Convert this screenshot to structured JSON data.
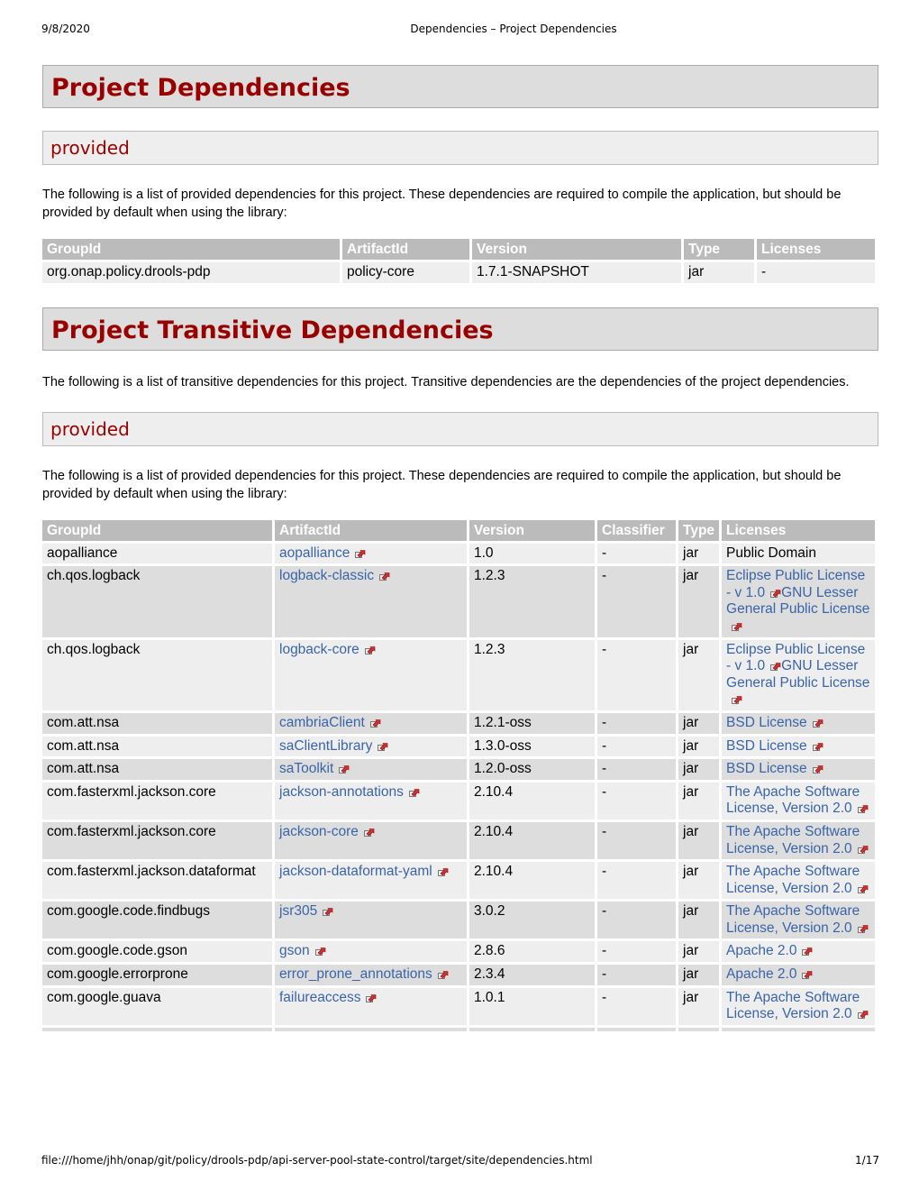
{
  "print": {
    "date": "9/8/2020",
    "title": "Dependencies – Project Dependencies",
    "url": "file:///home/jhh/onap/git/policy/drools-pdp/api-server-pool-state-control/target/site/dependencies.html",
    "page": "1/17"
  },
  "colors": {
    "heading": "#990000",
    "link": "#3a64a8",
    "table_header": "#bbbbbb",
    "row_odd": "#eeeeee",
    "row_even": "#dddddd"
  },
  "section1": {
    "title": "Project Dependencies",
    "subsection": "provided",
    "intro": "The following is a list of provided dependencies for this project. These dependencies are required to compile the application, but should be provided by default when using the library:",
    "columns": [
      "GroupId",
      "ArtifactId",
      "Version",
      "Type",
      "Licenses"
    ],
    "rows": [
      {
        "groupId": "org.onap.policy.drools-pdp",
        "artifactId": "policy-core",
        "version": "1.7.1-SNAPSHOT",
        "type": "jar",
        "licenses": "-"
      }
    ]
  },
  "section2": {
    "title": "Project Transitive Dependencies",
    "intro": "The following is a list of transitive dependencies for this project. Transitive dependencies are the dependencies of the project dependencies.",
    "subsection": "provided",
    "sub_intro": "The following is a list of provided dependencies for this project. These dependencies are required to compile the application, but should be provided by default when using the library:",
    "columns": [
      "GroupId",
      "ArtifactId",
      "Version",
      "Classifier",
      "Type",
      "Licenses"
    ],
    "rows": [
      {
        "groupId": "aopalliance",
        "artifactId": "aopalliance",
        "version": "1.0",
        "classifier": "-",
        "type": "jar",
        "licenses": [
          {
            "text": "Public Domain",
            "link": false
          }
        ]
      },
      {
        "groupId": "ch.qos.logback",
        "artifactId": "logback-classic",
        "version": "1.2.3",
        "classifier": "-",
        "type": "jar",
        "licenses": [
          {
            "text": "Eclipse Public License - v 1.0",
            "link": true
          },
          {
            "text": "GNU Lesser General Public License",
            "link": true
          }
        ]
      },
      {
        "groupId": "ch.qos.logback",
        "artifactId": "logback-core",
        "version": "1.2.3",
        "classifier": "-",
        "type": "jar",
        "licenses": [
          {
            "text": "Eclipse Public License - v 1.0",
            "link": true
          },
          {
            "text": "GNU Lesser General Public License",
            "link": true
          }
        ]
      },
      {
        "groupId": "com.att.nsa",
        "artifactId": "cambriaClient",
        "version": "1.2.1-oss",
        "classifier": "-",
        "type": "jar",
        "licenses": [
          {
            "text": "BSD License",
            "link": true
          }
        ]
      },
      {
        "groupId": "com.att.nsa",
        "artifactId": "saClientLibrary",
        "version": "1.3.0-oss",
        "classifier": "-",
        "type": "jar",
        "licenses": [
          {
            "text": "BSD License",
            "link": true
          }
        ]
      },
      {
        "groupId": "com.att.nsa",
        "artifactId": "saToolkit",
        "version": "1.2.0-oss",
        "classifier": "-",
        "type": "jar",
        "licenses": [
          {
            "text": "BSD License",
            "link": true
          }
        ]
      },
      {
        "groupId": "com.fasterxml.jackson.core",
        "artifactId": "jackson-annotations",
        "version": "2.10.4",
        "classifier": "-",
        "type": "jar",
        "licenses": [
          {
            "text": "The Apache Software License, Version 2.0",
            "link": true
          }
        ]
      },
      {
        "groupId": "com.fasterxml.jackson.core",
        "artifactId": "jackson-core",
        "version": "2.10.4",
        "classifier": "-",
        "type": "jar",
        "licenses": [
          {
            "text": "The Apache Software License, Version 2.0",
            "link": true
          }
        ]
      },
      {
        "groupId": "com.fasterxml.jackson.dataformat",
        "artifactId": "jackson-dataformat-yaml",
        "version": "2.10.4",
        "classifier": "-",
        "type": "jar",
        "licenses": [
          {
            "text": "The Apache Software License, Version 2.0",
            "link": true
          }
        ]
      },
      {
        "groupId": "com.google.code.findbugs",
        "artifactId": "jsr305",
        "version": "3.0.2",
        "classifier": "-",
        "type": "jar",
        "licenses": [
          {
            "text": "The Apache Software License, Version 2.0",
            "link": true
          }
        ]
      },
      {
        "groupId": "com.google.code.gson",
        "artifactId": "gson",
        "version": "2.8.6",
        "classifier": "-",
        "type": "jar",
        "licenses": [
          {
            "text": "Apache 2.0",
            "link": true
          }
        ]
      },
      {
        "groupId": "com.google.errorprone",
        "artifactId": "error_prone_annotations",
        "version": "2.3.4",
        "classifier": "-",
        "type": "jar",
        "licenses": [
          {
            "text": "Apache 2.0",
            "link": true
          }
        ]
      },
      {
        "groupId": "com.google.guava",
        "artifactId": "failureaccess",
        "version": "1.0.1",
        "classifier": "-",
        "type": "jar",
        "licenses": [
          {
            "text": "The Apache Software License, Version 2.0",
            "link": true
          }
        ]
      }
    ]
  }
}
